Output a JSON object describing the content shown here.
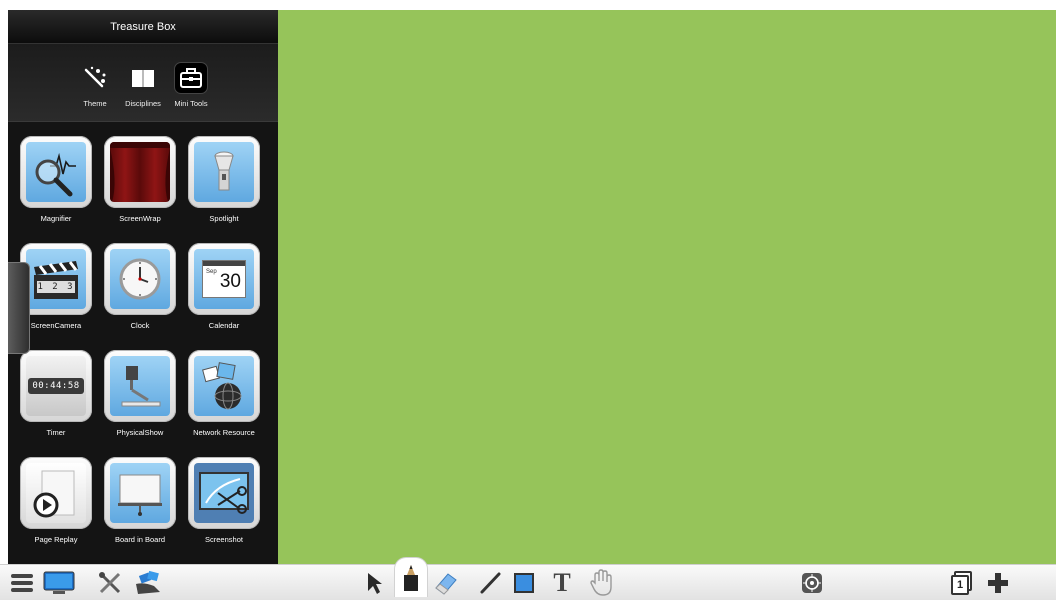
{
  "panel": {
    "title": "Treasure Box",
    "tabs": [
      {
        "label": "Theme",
        "icon": "magic-wand-icon"
      },
      {
        "label": "Disciplines",
        "icon": "book-icon"
      },
      {
        "label": "Mini Tools",
        "icon": "toolbox-icon",
        "active": true
      }
    ],
    "tools": [
      {
        "label": "Magnifier",
        "icon": "magnifier-icon"
      },
      {
        "label": "ScreenWrap",
        "icon": "curtain-icon"
      },
      {
        "label": "Spotlight",
        "icon": "flashlight-icon"
      },
      {
        "label": "ScreenCamera",
        "icon": "clapperboard-icon",
        "counter": "1 2 3"
      },
      {
        "label": "Clock",
        "icon": "clock-icon"
      },
      {
        "label": "Calendar",
        "icon": "calendar-icon",
        "month": "Sep",
        "day": "30"
      },
      {
        "label": "Timer",
        "icon": "timer-icon",
        "display": "00:44:58"
      },
      {
        "label": "PhysicalShow",
        "icon": "document-camera-icon"
      },
      {
        "label": "Network Resource",
        "icon": "globe-icon"
      },
      {
        "label": "Page Replay",
        "icon": "replay-icon"
      },
      {
        "label": "Board in Board",
        "icon": "easel-icon"
      },
      {
        "label": "Screenshot",
        "icon": "scissors-icon"
      }
    ]
  },
  "canvas": {
    "color": "#96c45a"
  },
  "toolbar": {
    "left": [
      "menu-icon",
      "monitor-icon",
      "tools-icon",
      "hand-cards-icon"
    ],
    "center": [
      "pointer-icon",
      "pen-icon",
      "eraser-icon",
      "line-icon",
      "rectangle-icon",
      "text-icon",
      "hand-icon"
    ],
    "center_active": "pen-icon",
    "text_tool_glyph": "T",
    "right": [
      "target-icon",
      "page-icon",
      "add-page-icon"
    ],
    "page_number": "1"
  }
}
